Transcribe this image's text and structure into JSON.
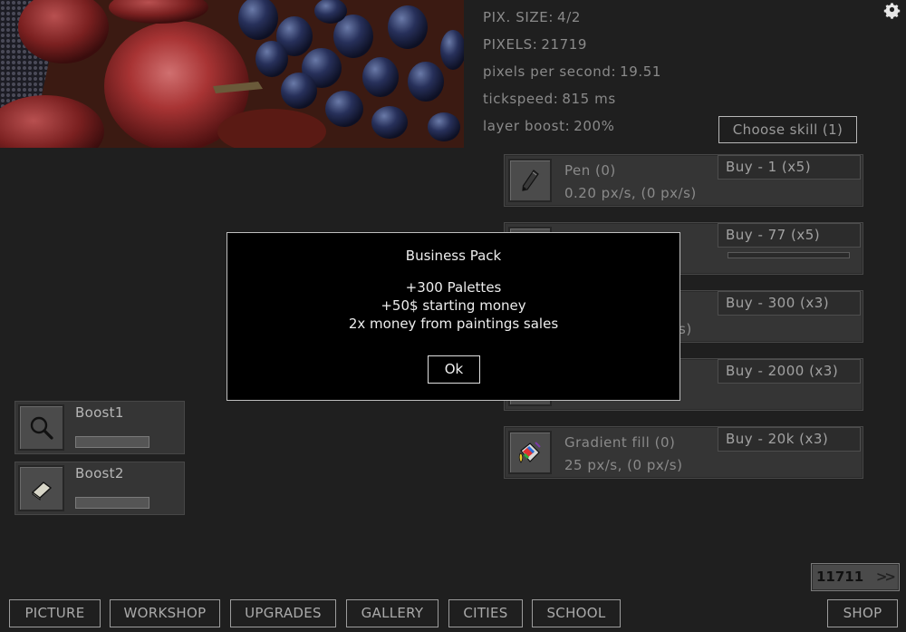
{
  "stats": {
    "pix_size_label": "PIX. SIZE:",
    "pix_size_value": "4/2",
    "pixels_label": "PIXELS:",
    "pixels_value": "21719",
    "pps_label": "pixels per second:",
    "pps_value": "19.51",
    "tickspeed_label": "tickspeed:",
    "tickspeed_value": "815 ms",
    "layer_boost_label": "layer boost:",
    "layer_boost_value": "200%"
  },
  "settings_icon": "gear-icon",
  "choose_skill_label": "Choose skill (1)",
  "tools": [
    {
      "name": "Pen (0)",
      "rate": "0.20 px/s, (0 px/s)",
      "buy": "Buy - 1 (x5)",
      "icon": "pen-icon"
    },
    {
      "name": "",
      "rate": "",
      "buy": "Buy - 77 (x5)",
      "icon": "",
      "progress": 0.0
    },
    {
      "name": "",
      "rate": "s)",
      "buy": "Buy - 300 (x3)",
      "icon": ""
    },
    {
      "name": "",
      "rate": "",
      "buy": "Buy - 2000 (x3)",
      "icon": ""
    },
    {
      "name": "Gradient fill (0)",
      "rate": "25 px/s, (0 px/s)",
      "buy": "Buy - 20k (x3)",
      "icon": "gradient-fill-icon"
    }
  ],
  "boosts": [
    {
      "label": "Boost1",
      "icon": "magnifier-icon",
      "progress": 0.0
    },
    {
      "label": "Boost2",
      "icon": "eraser-icon",
      "progress": 0.0
    }
  ],
  "counter": {
    "value": "11711",
    "arrows": ">>"
  },
  "nav": {
    "picture": "PICTURE",
    "workshop": "WORKSHOP",
    "upgrades": "UPGRADES",
    "gallery": "GALLERY",
    "cities": "CITIES",
    "school": "SCHOOL",
    "shop": "SHOP"
  },
  "modal": {
    "title": "Business Pack",
    "lines": [
      "+300 Palettes",
      "+50$ starting money",
      "2x money from paintings sales"
    ],
    "ok_label": "Ok"
  }
}
